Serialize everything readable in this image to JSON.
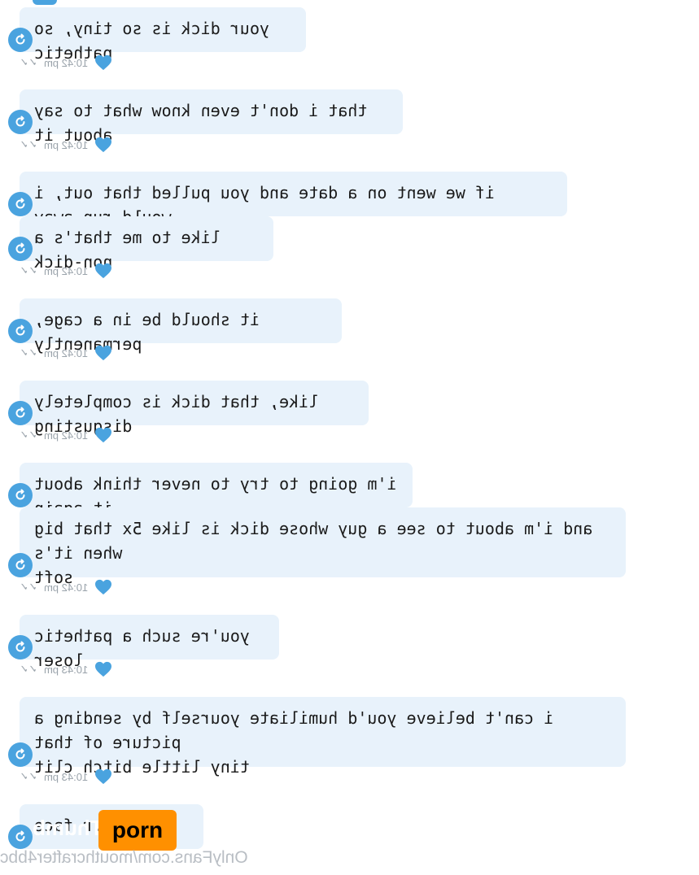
{
  "colors": {
    "bubble": "#e8f2fb",
    "avatar": "#4aa3df",
    "heart": "#4aa3df",
    "meta_text": "#9aa3ab",
    "watermark_badge": "#ff9000"
  },
  "icons": {
    "avatar": "reply-arrow-icon",
    "heart": "heart-icon",
    "ticks": "double-check-icon"
  },
  "messages": [
    {
      "text": "your dick is so tiny, so pathetic"
    },
    {
      "text": "that i don't even know what to say about it"
    },
    {
      "text": "if we went on a date and you pulled that out, i would run away"
    },
    {
      "text": "like to me that's a non-dick"
    },
    {
      "text": "it should be in a cage, permanently"
    },
    {
      "text": "like, that dick is completely disgusting"
    },
    {
      "text": "i'm going to try to never think about it again"
    },
    {
      "text": "and i'm about to see a guy whose dick is like 5x that big when it's\nsoft"
    },
    {
      "text": "you're such a pathetic loser"
    },
    {
      "text": "i can't believe you'd humiliate yourself by sending a picture of that\ntiny little bitch clit"
    },
    {
      "text": "s...r face"
    }
  ],
  "timestamps": [
    "10:42 pm",
    "10:42 pm",
    "10:42 pm",
    "10:42 pm",
    "10:42 pm",
    "10:42 pm",
    "10:43 pm",
    "10:43 pm"
  ],
  "ticks_glyph": "✓✓",
  "watermark": {
    "url": "OnlyFans.com/mouthcrafter4bbc",
    "badge": "porn",
    "ghost": "Thumb"
  }
}
